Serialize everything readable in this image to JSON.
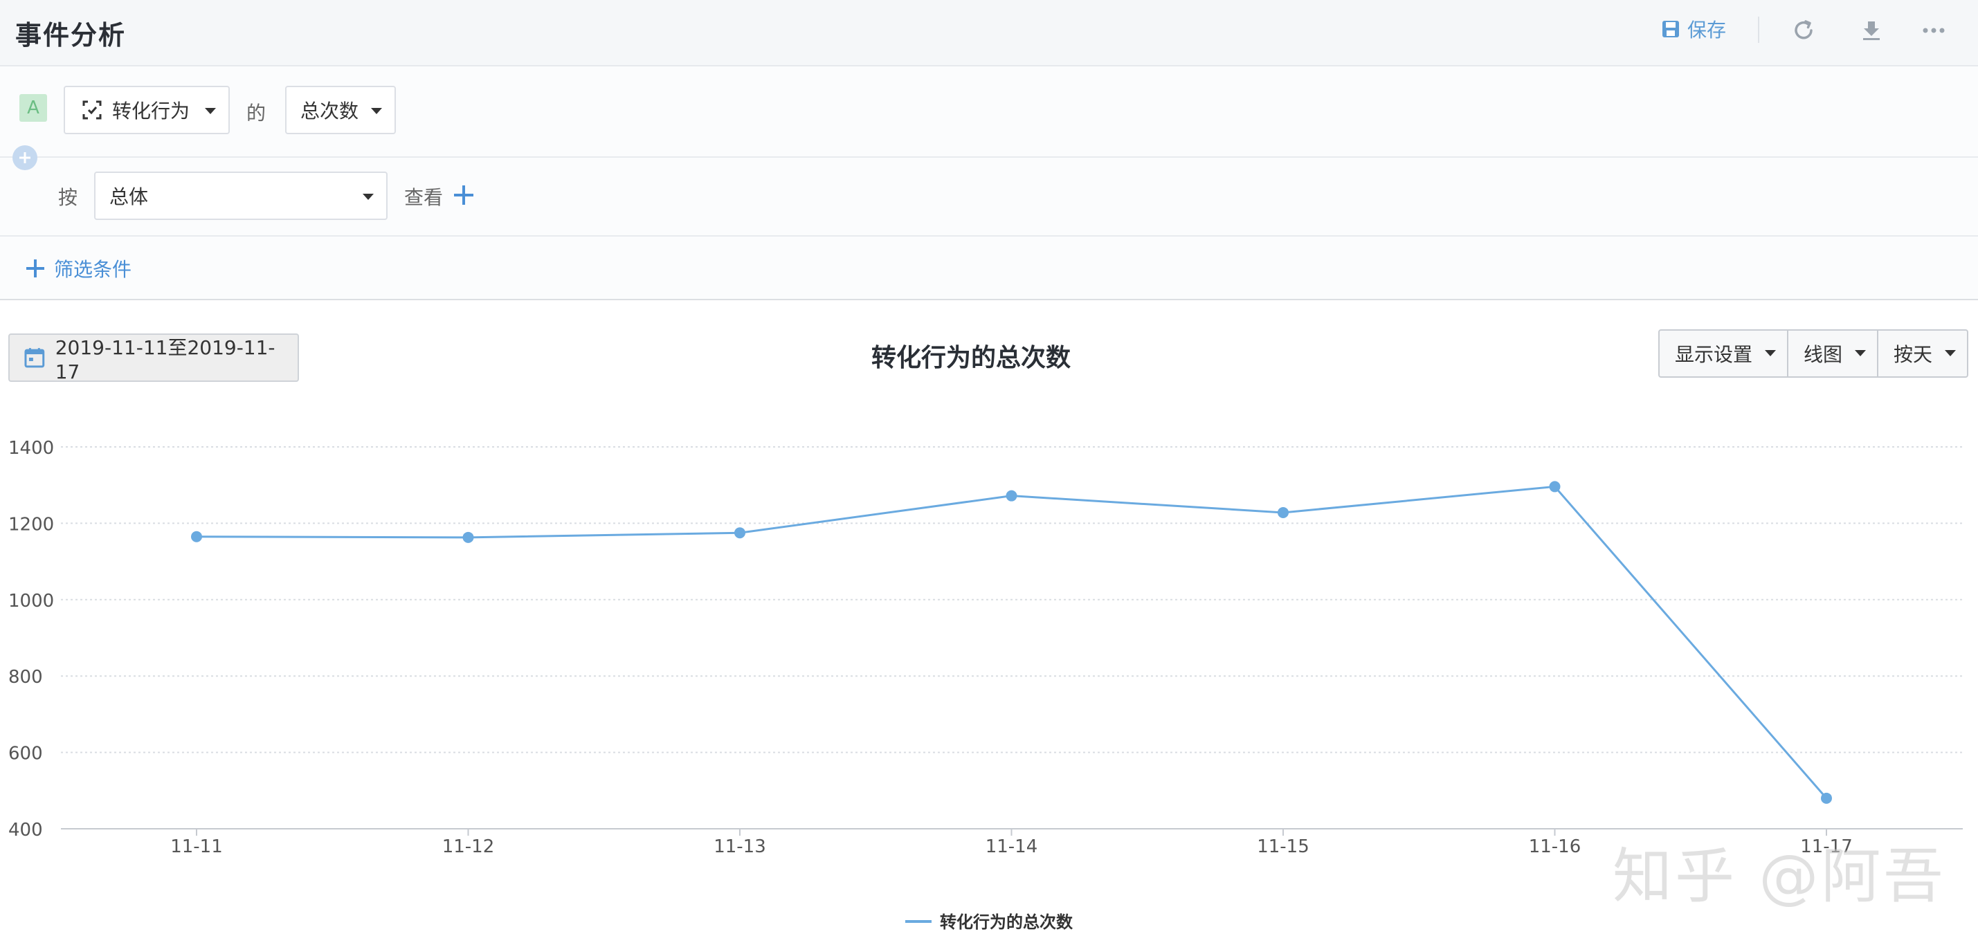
{
  "header": {
    "title": "事件分析",
    "save_label": "保存"
  },
  "query": {
    "badge": "A",
    "event_select": "转化行为",
    "of_text": "的",
    "metric_select": "总次数",
    "by_text": "按",
    "group_select": "总体",
    "view_text": "查看",
    "filter_label": "筛选条件"
  },
  "toolbar": {
    "date_range": "2019-11-11至2019-11-17",
    "display_settings": "显示设置",
    "chart_type": "线图",
    "granularity": "按天"
  },
  "watermark": "知乎 @阿吾",
  "colors": {
    "accent": "#5b9bd5",
    "line": "#6aaae0",
    "badge_bg": "#c9ead2",
    "badge_text": "#6bbd83"
  },
  "chart_data": {
    "type": "line",
    "title": "转化行为的总次数",
    "categories": [
      "11-11",
      "11-12",
      "11-13",
      "11-14",
      "11-15",
      "11-16",
      "11-17"
    ],
    "series": [
      {
        "name": "转化行为的总次数",
        "values": [
          1165,
          1163,
          1175,
          1272,
          1228,
          1296,
          480
        ]
      }
    ],
    "ylim": [
      400,
      1400
    ],
    "yticks": [
      400,
      600,
      800,
      1000,
      1200,
      1400
    ],
    "grid": true,
    "legend": "bottom-center"
  }
}
